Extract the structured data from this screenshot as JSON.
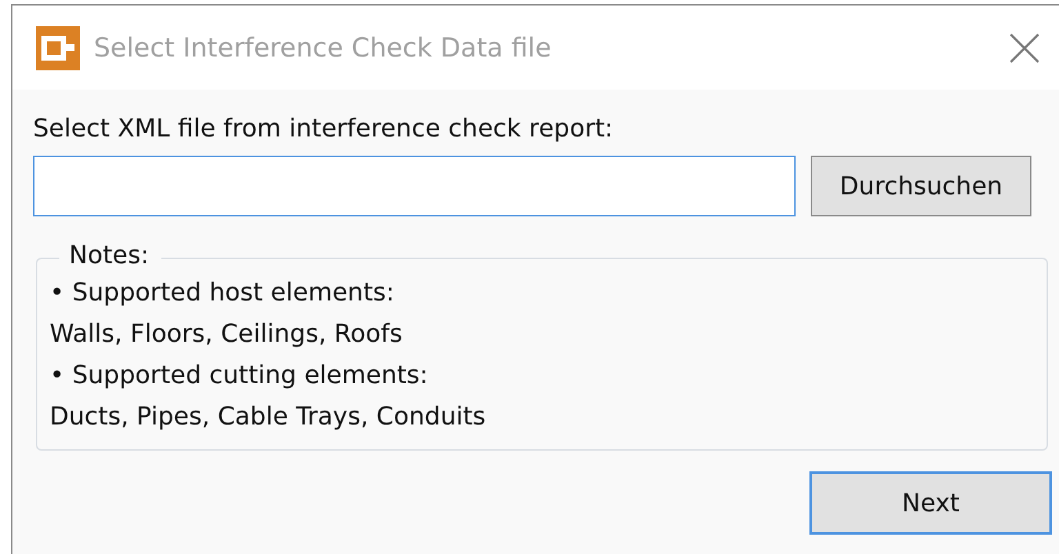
{
  "window": {
    "title": "Select Interference Check Data file"
  },
  "file_label": "Select XML file from interference check report:",
  "file_field": {
    "focused": true
  },
  "browse_button": "Durchsuchen",
  "notes": {
    "title": "Notes:",
    "lines": [
      "• Supported host elements:",
      "Walls, Floors, Ceilings, Roofs",
      "• Supported cutting elements:",
      "Ducts, Pipes, Cable Trays, Conduits"
    ]
  },
  "next_button": {
    "label": "Next",
    "default": true
  }
}
